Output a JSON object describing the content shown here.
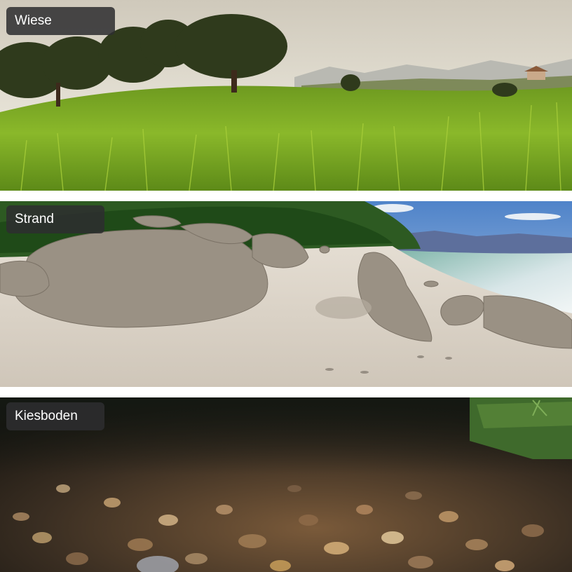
{
  "panels": [
    {
      "label": "Wiese"
    },
    {
      "label": "Strand"
    },
    {
      "label": "Kiesboden"
    }
  ],
  "colors": {
    "label_background": "#2d2d30",
    "label_text": "#ffffff",
    "separator": "#ffffff"
  }
}
